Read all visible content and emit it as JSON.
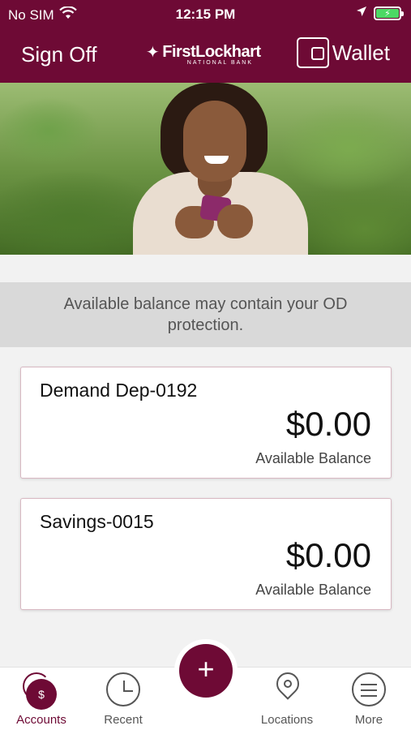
{
  "status_bar": {
    "carrier": "No SIM",
    "time": "12:15 PM"
  },
  "header": {
    "sign_off_label": "Sign Off",
    "logo_text": "FirstLockhart",
    "logo_subtext": "NATIONAL BANK",
    "wallet_label": "Wallet"
  },
  "notice": {
    "text": "Available balance may contain your OD protection."
  },
  "accounts": [
    {
      "name": "Demand Dep-0192",
      "amount": "$0.00",
      "label": "Available Balance"
    },
    {
      "name": "Savings-0015",
      "amount": "$0.00",
      "label": "Available Balance"
    }
  ],
  "tabbar": {
    "accounts": "Accounts",
    "recent": "Recent",
    "locations": "Locations",
    "more": "More",
    "add_icon": "+",
    "dollar_icon": "$"
  },
  "colors": {
    "brand": "#6e0a35",
    "battery": "#4cd964"
  }
}
